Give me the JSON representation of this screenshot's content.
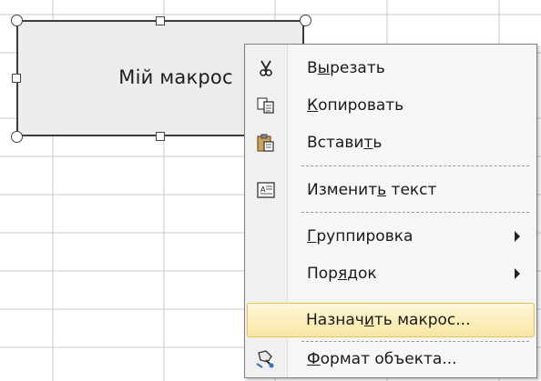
{
  "shape": {
    "label": "Мій макрос"
  },
  "context_menu": {
    "items": [
      {
        "id": "cut",
        "before": "В",
        "key": "ы",
        "after": "резать",
        "icon": "scissors-icon"
      },
      {
        "id": "copy",
        "before": "",
        "key": "К",
        "after": "опировать",
        "icon": "copy-icon"
      },
      {
        "id": "paste",
        "before": "Встави",
        "key": "т",
        "after": "ь",
        "icon": "paste-icon"
      },
      {
        "id": "edit-text",
        "before": "Изменит",
        "key": "ь",
        "after": " текст",
        "icon": "edit-text-icon"
      },
      {
        "id": "grouping",
        "before": "",
        "key": "Г",
        "after": "руппировка",
        "submenu": true
      },
      {
        "id": "order",
        "before": "Пор",
        "key": "я",
        "after": "док",
        "submenu": true
      },
      {
        "id": "assign-macro",
        "before": "Назнач",
        "key": "и",
        "after": "ть макрос...",
        "highlighted": true
      },
      {
        "id": "format-object",
        "before": "",
        "key": "Ф",
        "after": "ормат объекта...",
        "icon": "format-object-icon"
      }
    ]
  },
  "colors": {
    "highlight_top": "#fdf6d8",
    "highlight_bottom": "#f8e7a4",
    "highlight_border": "#e2c25c",
    "menu_bg": "#f6f6f6"
  }
}
